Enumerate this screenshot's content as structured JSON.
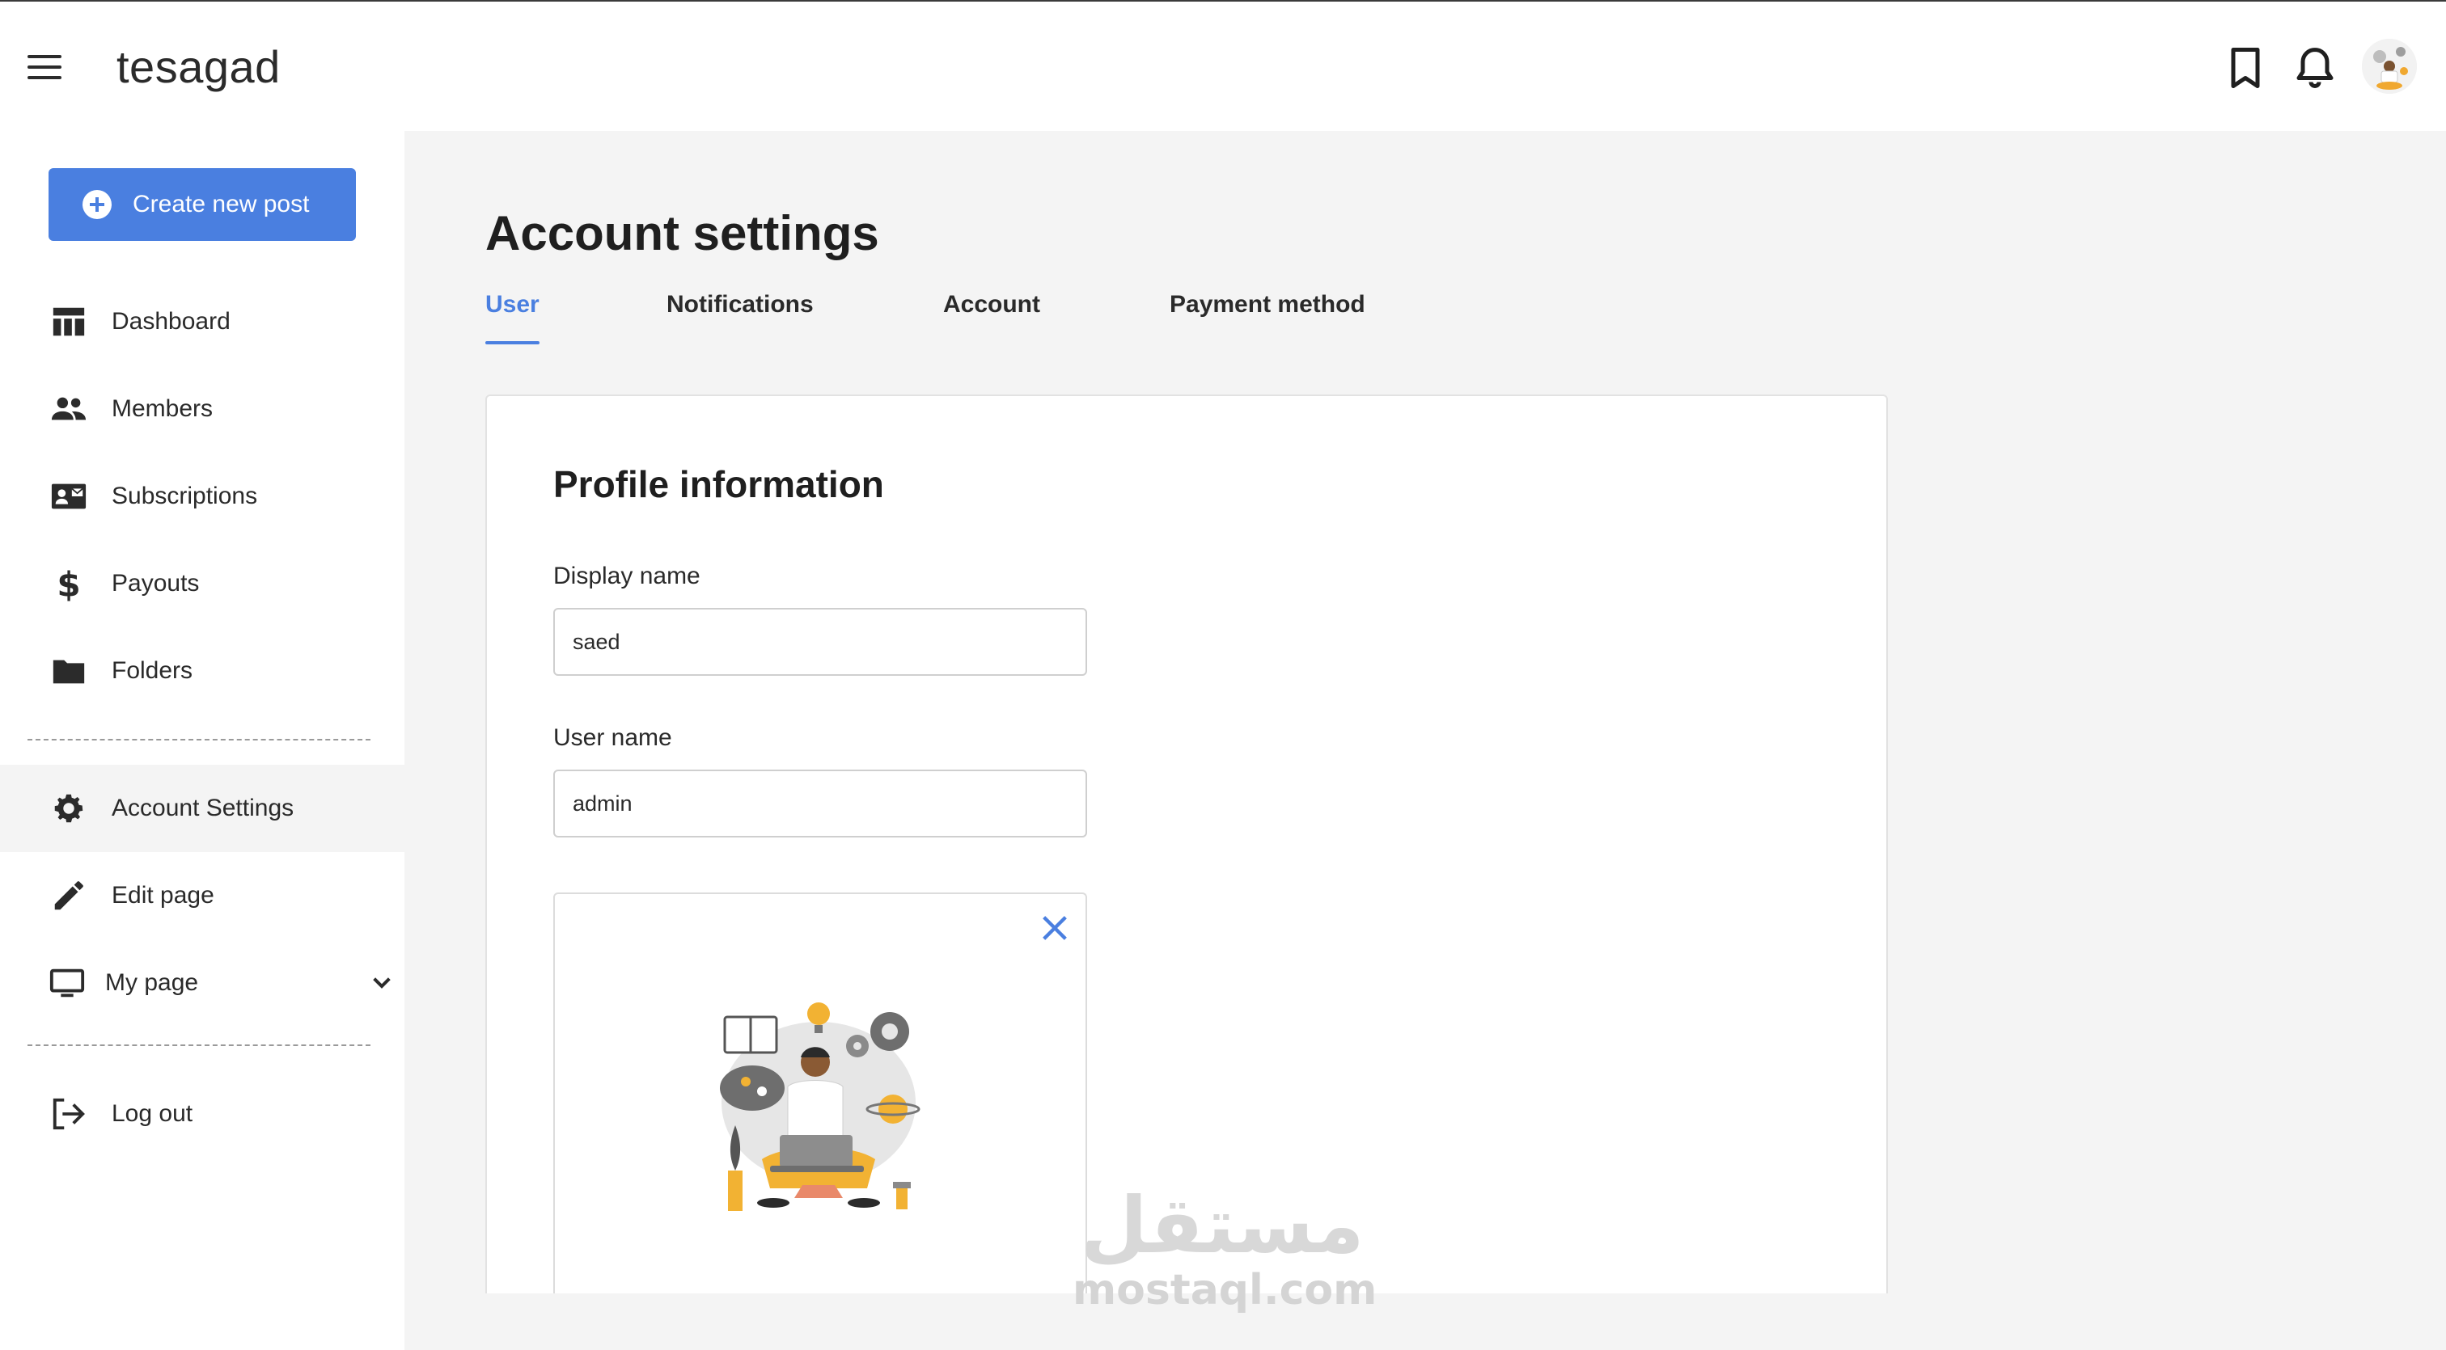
{
  "app": {
    "brand": "tesagad"
  },
  "sidebar": {
    "create_label": "Create new post",
    "items": [
      {
        "label": "Dashboard",
        "icon": "dashboard-icon"
      },
      {
        "label": "Members",
        "icon": "members-icon"
      },
      {
        "label": "Subscriptions",
        "icon": "subscriptions-icon"
      },
      {
        "label": "Payouts",
        "icon": "dollar-icon"
      },
      {
        "label": "Folders",
        "icon": "folder-icon"
      },
      {
        "label": "Account Settings",
        "icon": "gear-icon",
        "active": true
      },
      {
        "label": "Edit page",
        "icon": "pencil-icon"
      },
      {
        "label": "My page",
        "icon": "monitor-icon",
        "expandable": true
      },
      {
        "label": "Log out",
        "icon": "logout-icon"
      }
    ]
  },
  "main": {
    "title": "Account settings",
    "tabs": [
      {
        "label": "User",
        "active": true
      },
      {
        "label": "Notifications"
      },
      {
        "label": "Account"
      },
      {
        "label": "Payment method"
      }
    ],
    "card": {
      "title": "Profile information",
      "display_name_label": "Display name",
      "display_name_value": "saed",
      "username_label": "User name",
      "username_value": "admin"
    }
  },
  "watermark": {
    "arabic": "مستقل",
    "latin": "mostaql.com"
  },
  "colors": {
    "accent": "#4a7fe0",
    "background": "#f4f4f4",
    "text": "#1f1f1f"
  }
}
